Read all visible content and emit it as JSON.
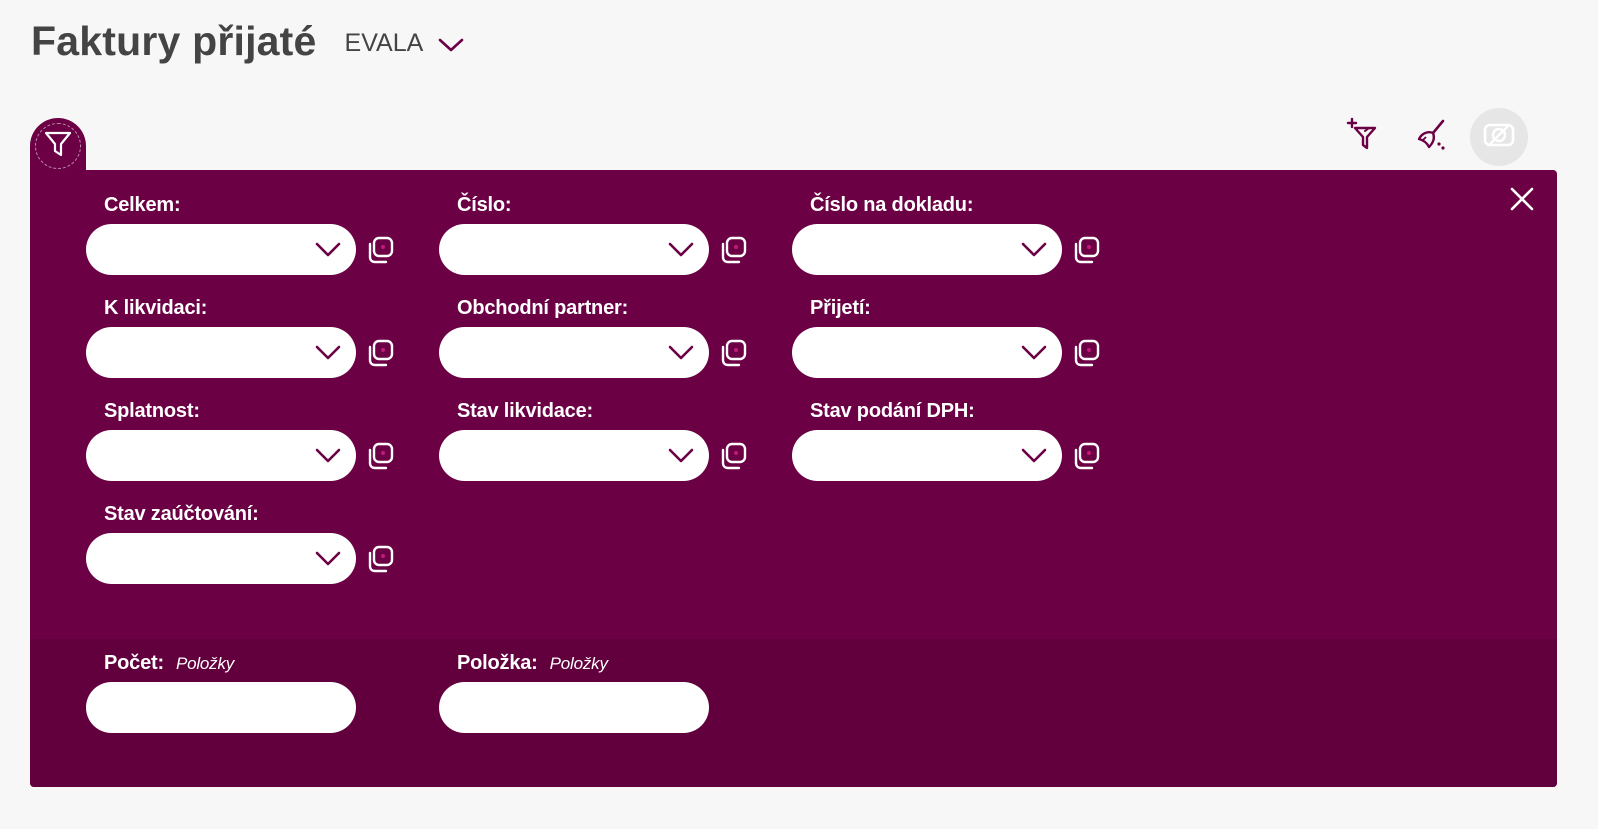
{
  "header": {
    "title": "Faktury přijaté",
    "company": "EVALA"
  },
  "colors": {
    "panel": "#6b0044",
    "panel_bottom": "#62003e",
    "accent": "#6b0044",
    "title_text": "#444444",
    "input_bg": "#ffffff"
  },
  "icons": {
    "filter_tab": "filter-icon",
    "add_filter": "filter-plus-icon",
    "clear_filter": "broom-icon",
    "disabled_action": "sync-off-icon",
    "close": "close-icon",
    "select": "chevron-down-icon",
    "copy": "copy-icon"
  },
  "filters": {
    "celkem": {
      "label": "Celkem:",
      "value": ""
    },
    "cislo": {
      "label": "Číslo:",
      "value": ""
    },
    "cislo_na_dokladu": {
      "label": "Číslo na dokladu:",
      "value": ""
    },
    "k_likvidaci": {
      "label": "K likvidaci:",
      "value": ""
    },
    "obchodni_partner": {
      "label": "Obchodní partner:",
      "value": ""
    },
    "prijeti": {
      "label": "Přijetí:",
      "value": ""
    },
    "splatnost": {
      "label": "Splatnost:",
      "value": ""
    },
    "stav_likvidace": {
      "label": "Stav likvidace:",
      "value": ""
    },
    "stav_podani_dph": {
      "label": "Stav podání DPH:",
      "value": ""
    },
    "stav_zauctovani": {
      "label": "Stav zaúčtování:",
      "value": ""
    }
  },
  "bottom_fields": {
    "pocet": {
      "label": "Počet:",
      "sub": "Položky",
      "value": ""
    },
    "polozka": {
      "label": "Položka:",
      "sub": "Položky",
      "value": ""
    }
  }
}
